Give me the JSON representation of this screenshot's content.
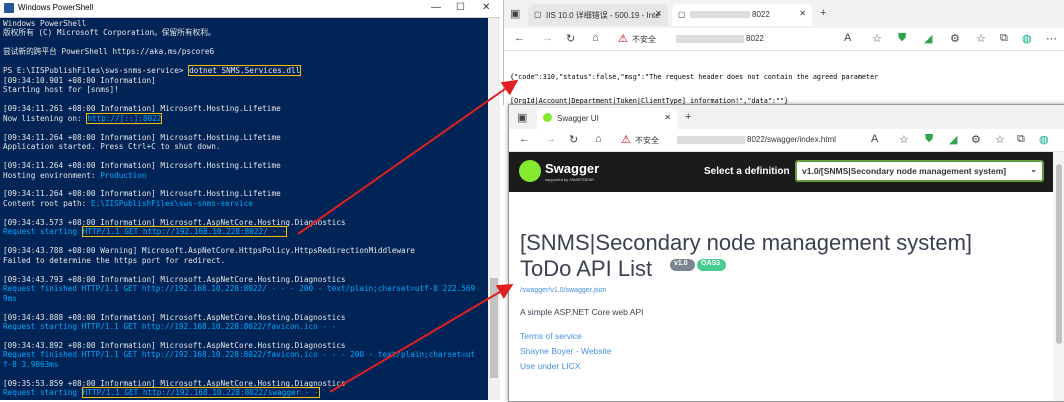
{
  "powershell": {
    "title": "Windows PowerShell",
    "lines": [
      "Windows PowerShell",
      "版权所有 (C) Microsoft Corporation。保留所有权利。",
      "",
      "尝试新的跨平台 PowerShell https://aka.ms/pscore6",
      "",
      "PS E:\\IISPublishFiles\\sws-snms-service> ",
      "[09:34:10.901 +08:00 Information]",
      "Starting host for [snms]!",
      "",
      "[09:34:11.261 +08:00 Information] Microsoft.Hosting.Lifetime",
      "Now listening on: ",
      "",
      "[09:34:11.264 +08:00 Information] Microsoft.Hosting.Lifetime",
      "Application started. Press Ctrl+C to shut down.",
      "",
      "[09:34:11.264 +08:00 Information] Microsoft.Hosting.Lifetime",
      "Hosting environment: ",
      "",
      "[09:34:11.264 +08:00 Information] Microsoft.Hosting.Lifetime",
      "Content root path: ",
      "",
      "[09:34:43.573 +08:00 Information] Microsoft.AspNetCore.Hosting.Diagnostics",
      "Request starting ",
      "",
      "[09:34:43.788 +08:00 Warning] Microsoft.AspNetCore.HttpsPolicy.HttpsRedirectionMiddleware",
      "Failed to determine the https port for redirect.",
      "",
      "[09:34:43.793 +08:00 Information] Microsoft.AspNetCore.Hosting.Diagnostics",
      "Request finished HTTP/1.1 GET http://192.168.10.228:8022/ - - - 200 - text/plain;charset=utf-8 222.569",
      "9ms",
      "",
      "[09:34:43.888 +08:00 Information] Microsoft.AspNetCore.Hosting.Diagnostics",
      "Request starting HTTP/1.1 GET http://192.168.10.228:8022/favicon.ico - -",
      "",
      "[09:34:43.892 +08:00 Information] Microsoft.AspNetCore.Hosting.Diagnostics",
      "Request finished HTTP/1.1 GET http://192.168.10.228:8022/favicon.ico - - - 200 - text/plain;charset=ut",
      "f-8 3.9863ms",
      "",
      "[09:35:53.859 +08:00 Information] Microsoft.AspNetCore.Hosting.Diagnostics",
      "Request starting "
    ],
    "command": "dotnet SNMS.Services.dll",
    "listen_url": "http://[::]:8022",
    "environment": "Production",
    "content_root": "E:\\IISPublishFiles\\sws-snms-service",
    "req1": "HTTP/1.1 GET http://192.168.10.228:8022/ - -",
    "req2": "HTTP/1.1 GET http://192.168.10.228:8022/swagger - -"
  },
  "browser1": {
    "tab1": "IIS 10.0 详细错误 - 500.19 - Inte",
    "tab2": "8022",
    "address_prefix": "不安全",
    "address": "8022",
    "body_line1": "{\"code\":310,\"status\":false,\"msg\":\"The request header does not contain the agreed parameter",
    "body_line2": "[OrgId|Account|Department|Token|ClientType] information!\",\"data\":\"\"}"
  },
  "browser2": {
    "tab1": "Swagger UI",
    "address_prefix": "不安全",
    "address": "8022/swagger/index.html",
    "logo_text": "Swagger",
    "logo_sub": "supported by SMARTBEAR",
    "select_label": "Select a definition",
    "select_value": "v1.0/[SNMS|Secondary node management system]",
    "title_line1": "[SNMS|Secondary node management system]",
    "title_line2": "ToDo API List",
    "version_badge": "v1.0",
    "oas_badge": "OAS3",
    "json_link": "/swagger/v1.0/swagger.json",
    "description": "A simple ASP.NET Core web API",
    "terms": "Terms of service",
    "contact": "Shayne Boyer - Website",
    "license": "Use under LICX"
  },
  "colors": {
    "ps_bg": "#012456",
    "highlight_box": "#f0c000",
    "swagger_green": "#85ea2d",
    "arrow": "#e02020"
  }
}
